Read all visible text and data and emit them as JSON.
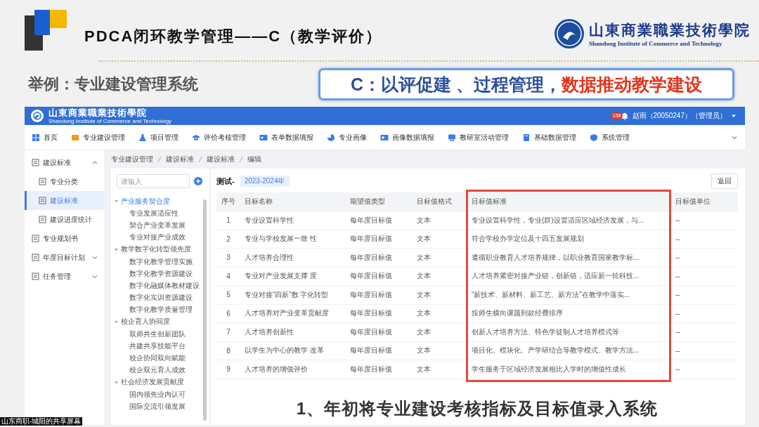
{
  "slide": {
    "title": "PDCA闭环教学管理——C（教学评价）",
    "school_name": "山東商業職業技術學院",
    "school_name_en": "Shandong Institute of Commerce and Technology",
    "example_label": "举例：专业建设管理系统",
    "slogan": [
      {
        "text": "C：以评促建 、过程管理，",
        "color": "#2b4f9e"
      },
      {
        "text": "数据推动教学建设",
        "color": "#e5321b"
      }
    ],
    "caption": "1、年初将专业建设考核指标及目标值录入系统",
    "share_label": "山东商职-城阳的共享屏幕"
  },
  "app": {
    "school_name": "山東商業職業技術學院",
    "school_name_en": "Shandong Institute of Commerce and Technology",
    "notification_count": "158",
    "user": "赵雨（20050247）（管理员）",
    "nav": [
      "首页",
      "专业建设管理",
      "项目管理",
      "评价考核管理",
      "表单数据填报",
      "专业画像",
      "画像数据填报",
      "教研室活动管理",
      "基础数据管理",
      "系统管理"
    ],
    "sidebar": [
      {
        "label": "建设标准",
        "kind": "group",
        "expanded": true,
        "selected": false,
        "children": [
          {
            "label": "专业分类",
            "selected": false
          },
          {
            "label": "建设标准",
            "selected": true
          },
          {
            "label": "建设进度统计",
            "selected": false
          }
        ]
      },
      {
        "label": "专业规划书",
        "kind": "item",
        "selected": false
      },
      {
        "label": "年度目标计划",
        "kind": "group",
        "expanded": false,
        "selected": false
      },
      {
        "label": "任务管理",
        "kind": "group",
        "expanded": false,
        "selected": false
      }
    ],
    "breadcrumb": [
      "专业建设管理",
      "建设标准",
      "建设标准",
      "编辑"
    ],
    "tree": {
      "placeholder": "请输入",
      "groups": [
        {
          "label": "产业服务契合度",
          "selected": true,
          "expanded": true,
          "children": [
            {
              "label": "专业发展适应性",
              "selected": false
            },
            {
              "label": "契合产业变革发展",
              "selected": false
            },
            {
              "label": "专业对接产业成效",
              "selected": false
            }
          ]
        },
        {
          "label": "教学数字化转型领先度",
          "selected": false,
          "expanded": true,
          "children": [
            {
              "label": "数字化教学管理实施",
              "selected": false
            },
            {
              "label": "数字化教学资源建设",
              "selected": false
            },
            {
              "label": "数字化融媒体教材建设",
              "selected": false
            },
            {
              "label": "数字化实训资源建设",
              "selected": false
            },
            {
              "label": "数字化教学质量管理",
              "selected": false
            }
          ]
        },
        {
          "label": "校企育人协同度",
          "selected": false,
          "expanded": true,
          "children": [
            {
              "label": "双师共生创新团队",
              "selected": false
            },
            {
              "label": "共建共享技能平台",
              "selected": false
            },
            {
              "label": "校企协同双向赋能",
              "selected": false
            },
            {
              "label": "校企双元育人成效",
              "selected": false
            }
          ]
        },
        {
          "label": "社会经济发展贡献度",
          "selected": false,
          "expanded": true,
          "children": [
            {
              "label": "国内领先业内认可",
              "selected": false
            },
            {
              "label": "国际交流引领发展",
              "selected": false
            }
          ]
        }
      ]
    },
    "table": {
      "title": "测试-",
      "year_tag": "2023-2024年",
      "back_button": "返回",
      "columns": [
        "序号",
        "目标名称",
        "期望值类型",
        "目标值格式",
        "目标值标准",
        "目标值单位"
      ],
      "rows": [
        [
          "1",
          "专业设置科学性",
          "每年度目标值",
          "文本",
          "专业设置科学性，专业(群)设置适应区域经济发展，与...",
          "--"
        ],
        [
          "2",
          "专业与学校发展一致 性",
          "每年度目标值",
          "文本",
          "符合学校办学定位及十四五发展规划",
          "--"
        ],
        [
          "3",
          "人才培养合理性",
          "每年度目标值",
          "文本",
          "遵循职业教育人才培养规律，以职业教育国家教学标...",
          "--"
        ],
        [
          "4",
          "专业对产业发展支撑 度",
          "每年度目标值",
          "文本",
          "人才培养紧密对接产业链，创新链，适应新一轮科技...",
          "--"
        ],
        [
          "5",
          "专业对接“四新”数 字化转型",
          "每年度目标值",
          "文本",
          "“新技术、新材料、新工艺、新方法”在教学中落实...",
          "--"
        ],
        [
          "6",
          "人才培养对产业变革贡献度",
          "每年度目标值",
          "文本",
          "按师生横向课题到款经费排序",
          "--"
        ],
        [
          "7",
          "人才培养创新性",
          "每年度目标值",
          "文本",
          "创新人才培养方法、特色学徒制人才培养模式等",
          "--"
        ],
        [
          "8",
          "以学生为中心的教学 改革",
          "每年度目标值",
          "文本",
          "项目化、模块化、产学研结合等教学模式、教学方法...",
          "--"
        ],
        [
          "9",
          "人才培养的增值评价",
          "每年度目标值",
          "文本",
          "学生服务于区域经济发展相比入学时的增值性成长",
          "--"
        ]
      ]
    }
  }
}
